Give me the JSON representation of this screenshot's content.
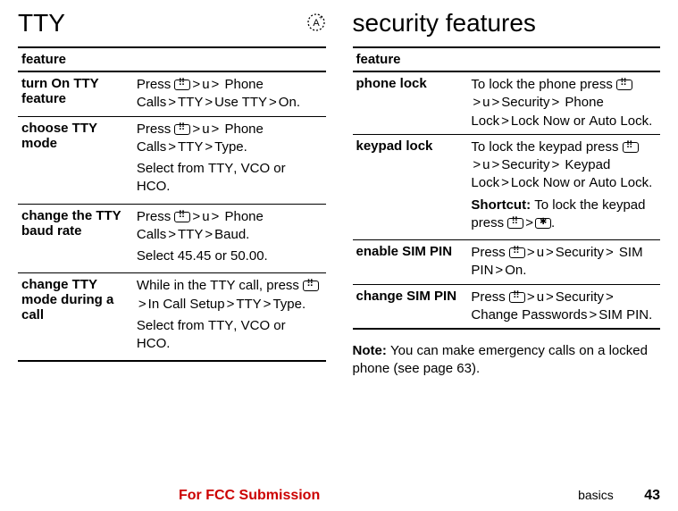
{
  "left": {
    "heading": "TTY",
    "accessibility_icon_name": "accessibility-icon",
    "header": "feature",
    "rows": [
      {
        "label": "turn On TTY feature",
        "press": "Press ",
        "seq1": "Phone Calls",
        "seq2": "TTY",
        "seq3": "Use TTY",
        "seq4": "On"
      },
      {
        "label": "choose TTY mode",
        "press": "Press ",
        "seq1": "Phone Calls",
        "seq2": "TTY",
        "seq3": "Type",
        "select_intro": "Select from ",
        "opt1": "TTY",
        "opt2": "VCO",
        "opt3": "HCO"
      },
      {
        "label": "change the TTY baud rate",
        "press": "Press ",
        "seq1": "Phone Calls",
        "seq2": "TTY",
        "seq3": "Baud",
        "select_intro": "Select ",
        "opt1": "45.45",
        "opt2": "50.00"
      },
      {
        "label": "change TTY mode during a call",
        "intro": "While in the TTY call, press ",
        "seq1": "In Call Setup",
        "seq2": "TTY",
        "seq3": "Type",
        "select_intro": "Select from ",
        "opt1": "TTY",
        "opt2": "VCO",
        "opt3": "HCO"
      }
    ]
  },
  "right": {
    "heading": "security features",
    "header": "feature",
    "rows": [
      {
        "label": "phone lock",
        "intro": "To lock the phone press ",
        "seq1": "Security",
        "seq2": "Phone Lock",
        "seq3": "Lock Now",
        "or_text": " or ",
        "seq4": "Auto Lock"
      },
      {
        "label": "keypad lock",
        "intro": "To lock the keypad press ",
        "seq1": "Security",
        "seq2": "Keypad Lock",
        "seq3": "Lock Now",
        "or_text": " or ",
        "seq4": "Auto Lock",
        "shortcut_label": "Shortcut: ",
        "shortcut_text": "To lock the keypad press "
      },
      {
        "label": "enable SIM PIN",
        "press": "Press ",
        "seq1": "Security",
        "seq2": "SIM PIN",
        "seq3": "On"
      },
      {
        "label": "change SIM PIN",
        "press": " Press ",
        "seq1": "Security",
        "seq2": "Change Passwords",
        "seq3": "SIM PIN"
      }
    ],
    "note_label": "Note: ",
    "note_text": "You can make emergency calls on a locked phone (see page 63)."
  },
  "footer": {
    "fcc": "For FCC Submission",
    "section": "basics",
    "page": "43"
  }
}
